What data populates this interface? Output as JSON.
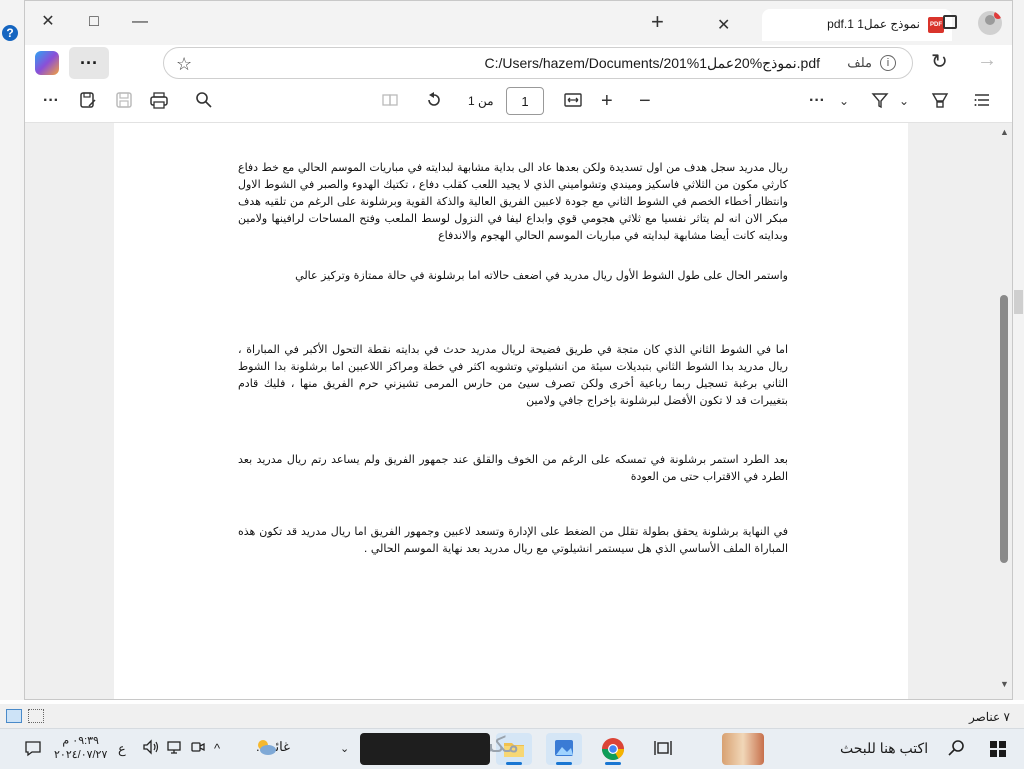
{
  "browser": {
    "tab_title": "نموذج عمل1 pdf.1",
    "pdf_icon_text": "PDF",
    "window_controls": {
      "minimize": "—",
      "maximize": "□",
      "close": "✕"
    },
    "new_tab": "+",
    "tab_close": "✕",
    "address": {
      "url": "C:/Users/hazem/Documents/201%1نموذج%20عمل.pdf",
      "file_label": "ملف",
      "info_glyph": "i"
    },
    "more_glyph": "···",
    "star_glyph": "☆",
    "reload_glyph": "↻",
    "forward_glyph": "→"
  },
  "pdf_toolbar": {
    "page_current": "1",
    "page_of": "من 1",
    "icons": [
      "more-icon",
      "save-as-icon",
      "save-icon",
      "print-icon",
      "search-icon",
      "page-view-icon",
      "rotate-icon",
      "fit-width-icon",
      "zoom-in-icon",
      "zoom-out-icon",
      "more-tools-icon",
      "draw-icon",
      "highlight-icon",
      "contents-icon"
    ]
  },
  "document": {
    "paragraphs": [
      "ريال مدريد سجل هدف من اول تسديدة ولكن بعدها عاد الى بداية مشابهة لبدايته في مباريات الموسم الحالي مع خط دفاع كارثي مكون من الثلاثي فاسكيز وميندي وتشواميني الذي لا يجيد اللعب كقلب دفاع ، تكتيك الهدوء والصبر في الشوط الاول وانتظار أخطاء الخصم في الشوط الثاني مع جودة لاعبين الفريق العالية والذكة القوية وبرشلونة على الرغم من تلقيه هدف مبكر الان انه لم يتاثر نفسيا مع ثلاثي هجومي قوي وابداع ليفا في النزول لوسط الملعب وفتح المساحات لرافينها ولامين  وبدايته كانت أيضا مشابهة لبدايته في مباريات الموسم الحالي الهجوم والاندفاع",
      "واستمر الحال على طول الشوط الأول ريال مدريد في اضعف حالاته اما برشلونة في حالة ممتازة وتركيز عالي",
      "اما في الشوط الثاني الذي كان متجة في طريق فضيحة لريال مدريد حدث في بدايته نقطة التحول الأكبر في المباراة ، ريال مدريد بدا الشوط الثاني بتبديلات سيئة من انشيلوتي وتشويه اكثر في خطة ومراكز اللاعبين اما برشلونة بدا الشوط الثاني برغبة تسجيل ربما رباعية أخرى ولكن تصرف سيئ من حارس المرمى تشيزني حرم الفريق منها ، فليك قادم بتغييرات قد لا تكون الأفضل لبرشلونة بإخراج جافي ولامين",
      "بعد الطرد استمر برشلونة في تمسكه على الرغم من الخوف والقلق عند جمهور الفريق ولم يساعد رتم ريال مدريد بعد الطرد في الاقتراب حتى من العودة",
      "في النهاية برشلونة يحقق بطولة تقلل من الضغط على الإدارة وتسعد لاعبين وجمهور الفريق اما ريال مدريد قد تكون هذه المباراة الملف الأساسي الذي هل سيستمر انشيلوتي مع ريال مدريد بعد نهاية الموسم الحالي ."
    ]
  },
  "statusbar": {
    "items_count": "٧ عناصر"
  },
  "taskbar": {
    "search_placeholder": "اكتب هنا للبحث",
    "weather_text": "غائم...",
    "time": "٠٩:٣٩ م",
    "date": "٢٠٢٤/٠٧/٢٧",
    "language": "ع",
    "watermark": "مكسات"
  },
  "colors": {
    "accent": "#0078d4",
    "pdf_red": "#d9342b",
    "page_bg": "#ffffff",
    "viewer_bg": "#efefef"
  }
}
